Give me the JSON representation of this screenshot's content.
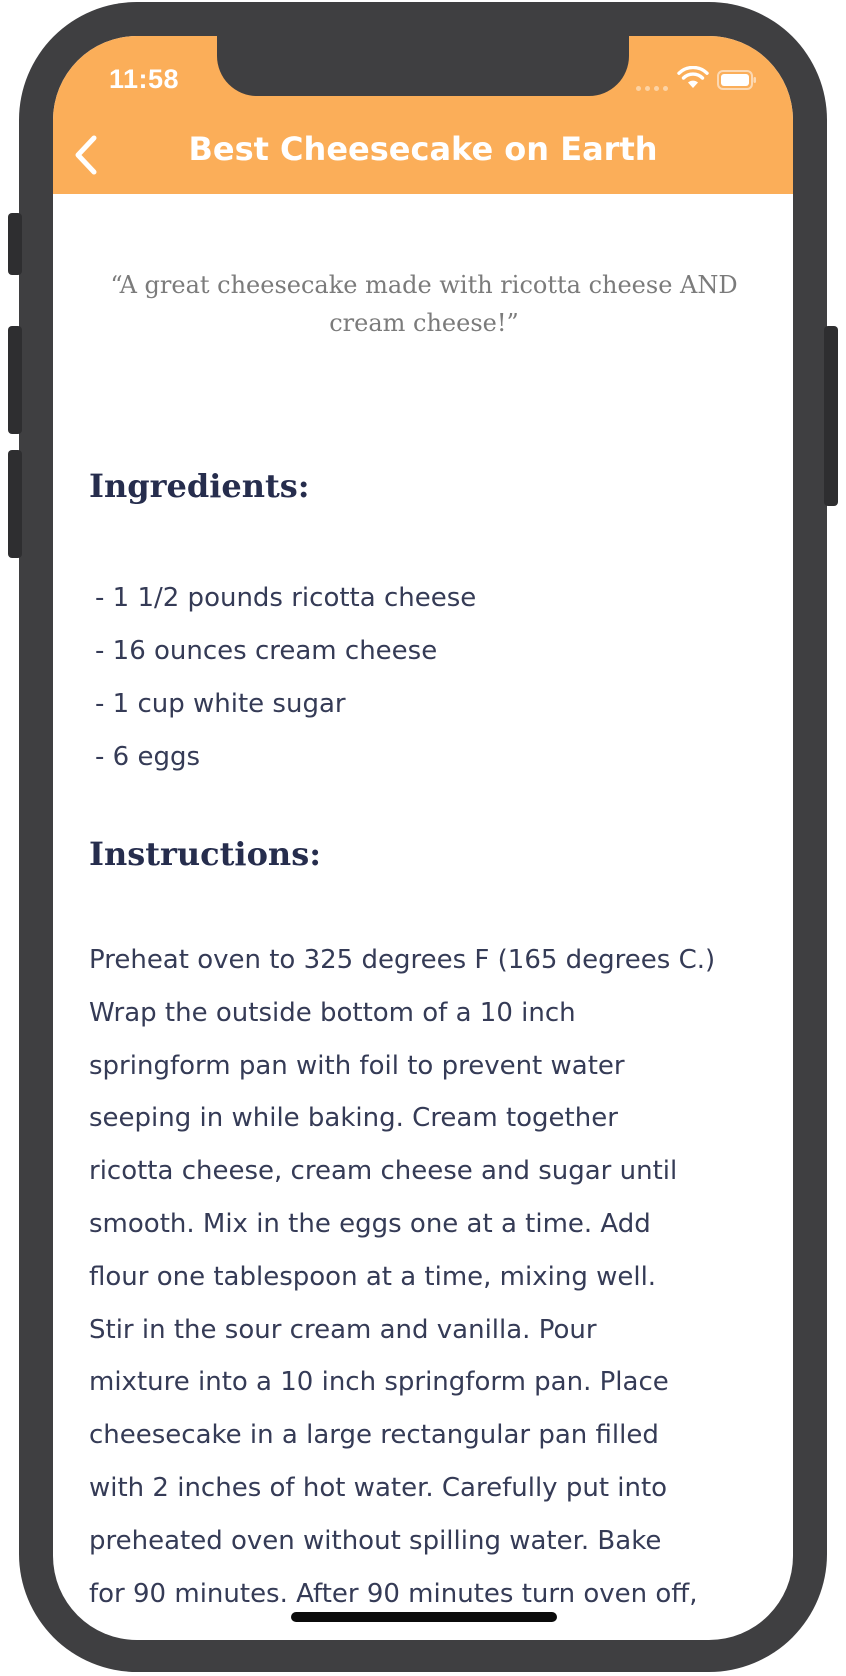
{
  "status_bar": {
    "time": "11:58"
  },
  "header": {
    "title": "Best Cheesecake on Earth",
    "background": "#fbae59",
    "back_icon": "chevron-left-icon"
  },
  "recipe": {
    "quote": "“A great cheesecake made with ricotta cheese AND cream cheese!”",
    "ingredients_heading": "Ingredients:",
    "ingredients": [
      "- 1 1/2 pounds ricotta cheese",
      "- 16 ounces cream cheese",
      "- 1 cup white sugar",
      "- 6 eggs"
    ],
    "instructions_heading": "Instructions:",
    "instructions_lines": [
      "Preheat oven to 325 degrees F (165 degrees C.)",
      "Wrap the outside bottom of a 10 inch",
      "springform pan with foil to prevent water",
      "seeping in while baking. Cream together",
      "ricotta cheese, cream cheese and sugar until",
      "smooth. Mix in the eggs one at a time. Add",
      "flour one tablespoon at a time, mixing well.",
      "Stir in the sour cream and vanilla. Pour",
      "mixture into a 10 inch springform pan. Place",
      "cheesecake in a large rectangular pan filled",
      "with 2 inches of hot water. Carefully put into",
      "preheated oven without spilling water. Bake",
      "for 90 minutes. After 90 minutes turn oven off,"
    ]
  },
  "colors": {
    "accent": "#fbae59",
    "heading": "#262d4d",
    "body_text": "#353b56",
    "quote_text": "#7b7b7b",
    "device_frame": "#3f3f41"
  }
}
